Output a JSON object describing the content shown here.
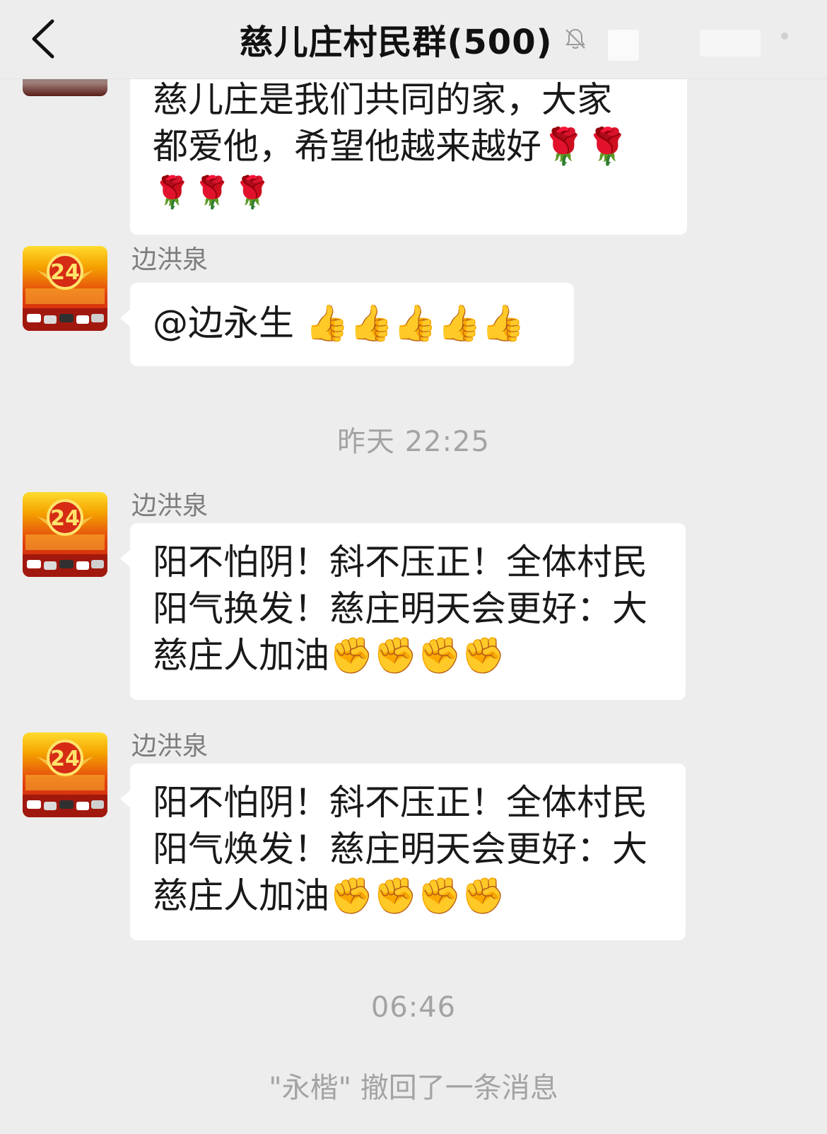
{
  "header": {
    "title": "慈儿庄村民群(500)"
  },
  "messages": [
    {
      "sender": "",
      "text_line1": "慈儿庄是我们共同的家，大家",
      "text_line2": "都爱他，希望他越来越好🌹🌹",
      "text_line3": "🌹🌹🌹"
    },
    {
      "sender": "边洪泉",
      "text": "@边永生 👍👍👍👍👍"
    },
    {
      "sender": "边洪泉",
      "text": "阳不怕阴！斜不压正！全体村民阳气换发！慈庄明天会更好：大慈庄人加油✊✊✊✊"
    },
    {
      "sender": "边洪泉",
      "text": "阳不怕阴！斜不压正！全体村民阳气焕发！慈庄明天会更好：大慈庄人加油✊✊✊✊"
    }
  ],
  "avatar_badge": "24",
  "timestamps": [
    "昨天 22:25",
    "06:46"
  ],
  "system_notice": "\"永楷\" 撤回了一条消息",
  "icons": {
    "back": "chevron-left-icon",
    "mute": "bell-off-icon",
    "more": "more-dots-icon"
  },
  "colors": {
    "background": "#ededed",
    "bubble": "#ffffff",
    "meta_text": "#a3a3a3"
  }
}
